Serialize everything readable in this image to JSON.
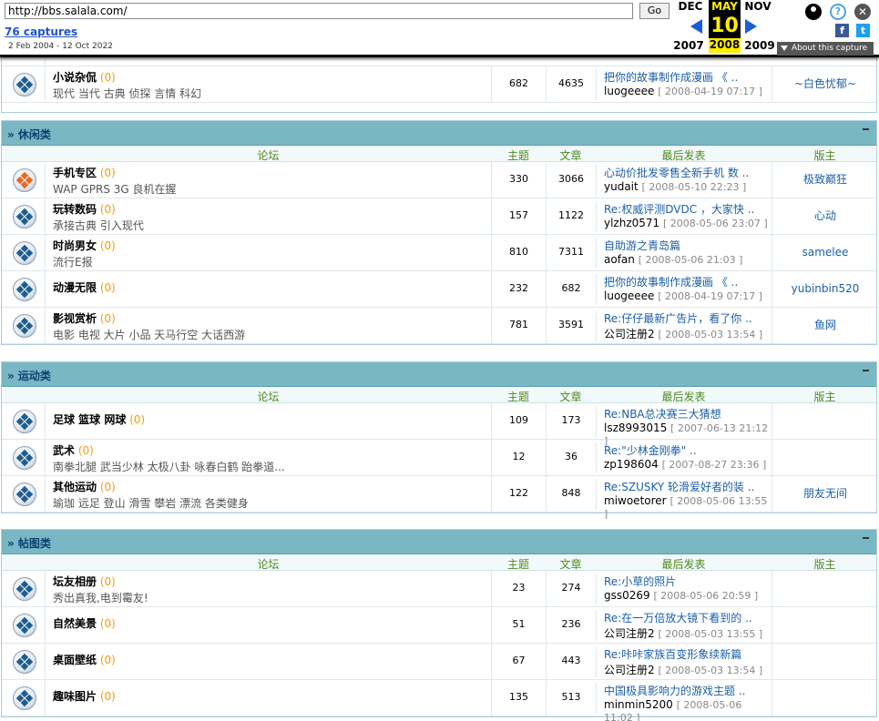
{
  "wayback": {
    "url": "http://bbs.salala.com/",
    "go_label": "Go",
    "captures": "76 captures",
    "range": "2 Feb 2004 - 12 Oct 2022",
    "prev_month": "DEC",
    "cur_month": "MAY",
    "next_month": "NOV",
    "cur_day": "10",
    "prev_year": "2007",
    "cur_year": "2008",
    "next_year": "2009",
    "about": "About this capture",
    "help_glyph": "?",
    "close_glyph": "✕",
    "fb_glyph": "f",
    "tw_glyph": "t"
  },
  "columns": {
    "forum": "论坛",
    "topics": "主题",
    "posts": "文章",
    "last": "最后发表",
    "mods": "版主"
  },
  "top_row": {
    "name": "小说杂侃",
    "count": "(0)",
    "sub": "现代 当代 古典 侦探 言情 科幻",
    "topics": "682",
    "posts": "4635",
    "last_title": "把你的故事制作成漫画 《 ..",
    "last_author": "luogeeee",
    "last_time": "[ 2008-04-19 07:17 ]",
    "mod": "~白色忧郁~"
  },
  "sections": [
    {
      "title": "» 休闲类",
      "rows": [
        {
          "name": "手机专区",
          "count": "(0)",
          "sub": "WAP GPRS 3G 良机在握",
          "hot": true,
          "topics": "330",
          "posts": "3066",
          "last_title": "心动价批发零售全新手机 数 ..",
          "last_author": "yudait",
          "last_time": "[ 2008-05-10 22:23 ]",
          "mod": "极致巅狂"
        },
        {
          "name": "玩转数码",
          "count": "(0)",
          "sub": "承接古典 引入现代",
          "topics": "157",
          "posts": "1122",
          "last_title": "Re:权威评测DVDC ，大家快 ..",
          "last_author": "ylzhz0571",
          "last_time": "[ 2008-05-06 23:07 ]",
          "mod": "心动"
        },
        {
          "name": "时尚男女",
          "count": "(0)",
          "sub": "流行E报",
          "topics": "810",
          "posts": "7311",
          "last_title": "自助游之青岛篇",
          "last_author": "aofan",
          "last_time": "[ 2008-05-06 21:03 ]",
          "mod": "samelee"
        },
        {
          "name": "动漫无限",
          "count": "(0)",
          "sub": "",
          "topics": "232",
          "posts": "682",
          "last_title": "把你的故事制作成漫画 《 ..",
          "last_author": "luogeeee",
          "last_time": "[ 2008-04-19 07:17 ]",
          "mod": "yubinbin520"
        },
        {
          "name": "影视赏析",
          "count": "(0)",
          "sub": "电影 电视 大片 小品 天马行空 大话西游",
          "topics": "781",
          "posts": "3591",
          "last_title": "Re:仔仔最新广告片，看了你 ..",
          "last_author": "公司注册2",
          "last_time": "[ 2008-05-03 13:54 ]",
          "mod": "鱼网"
        }
      ]
    },
    {
      "title": "» 运动类",
      "rows": [
        {
          "name": "足球 篮球 网球",
          "count": "(0)",
          "sub": "",
          "topics": "109",
          "posts": "173",
          "last_title": "Re:NBA总决赛三大猜想",
          "last_author": "lsz8993015",
          "last_time": "[ 2007-06-13 21:12 ]",
          "mod": ""
        },
        {
          "name": "武术",
          "count": "(0)",
          "sub": "南拳北腿 武当少林 太极八卦 咏春白鹤 跆拳道...",
          "topics": "12",
          "posts": "36",
          "last_title": "Re:\"少林金刚拳\" ..",
          "last_author": "zp198604",
          "last_time": "[ 2007-08-27 23:36 ]",
          "mod": ""
        },
        {
          "name": "其他运动",
          "count": "(0)",
          "sub": "瑜珈 远足 登山 滑雪 攀岩 漂流 各类健身",
          "topics": "122",
          "posts": "848",
          "last_title": "Re:SZUSKY 轮滑爱好者的装 ..",
          "last_author": "miwoetorer",
          "last_time": "[ 2008-05-06 13:55 ]",
          "mod": "朋友无间"
        }
      ]
    },
    {
      "title": "» 帖图类",
      "rows": [
        {
          "name": "坛友相册",
          "count": "(0)",
          "sub": "秀出真我,电到霉友!",
          "topics": "23",
          "posts": "274",
          "last_title": "Re:小草的照片",
          "last_author": "gss0269",
          "last_time": "[ 2008-05-06 20:59 ]",
          "mod": ""
        },
        {
          "name": "自然美景",
          "count": "(0)",
          "sub": "",
          "topics": "51",
          "posts": "236",
          "last_title": "Re:在一万倍放大镜下看到的 ..",
          "last_author": "公司注册2",
          "last_time": "[ 2008-05-03 13:55 ]",
          "mod": ""
        },
        {
          "name": "桌面壁纸",
          "count": "(0)",
          "sub": "",
          "topics": "67",
          "posts": "443",
          "last_title": "Re:咔咔家族百变形象续新篇",
          "last_author": "公司注册2",
          "last_time": "[ 2008-05-03 13:54 ]",
          "mod": ""
        },
        {
          "name": "趣味图片",
          "count": "(0)",
          "sub": "",
          "topics": "135",
          "posts": "513",
          "last_title": "中国极具影响力的游戏主题 ..",
          "last_author": "minmin5200",
          "last_time": "[ 2008-05-06 11:02 ]",
          "mod": ""
        }
      ]
    }
  ]
}
